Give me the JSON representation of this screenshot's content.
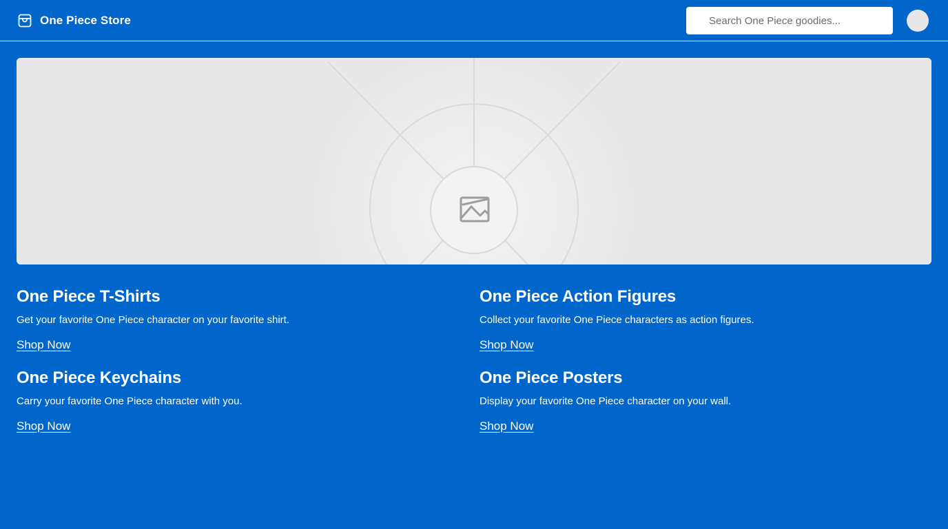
{
  "header": {
    "title": "One Piece Store",
    "search": {
      "placeholder": "Search One Piece goodies...",
      "value": ""
    }
  },
  "hero": {
    "image": "image-placeholder-icon"
  },
  "products": [
    {
      "title": "One Piece T-Shirts",
      "description": "Get your favorite One Piece character on your favorite shirt.",
      "link": "Shop Now"
    },
    {
      "title": "One Piece Action Figures",
      "description": "Collect your favorite One Piece characters as action figures.",
      "link": "Shop Now"
    },
    {
      "title": "One Piece Keychains",
      "description": "Carry your favorite One Piece character with you.",
      "link": "Shop Now"
    },
    {
      "title": "One Piece Posters",
      "description": "Display your favorite One Piece character on your wall.",
      "link": "Shop Now"
    }
  ],
  "colors": {
    "background": "#0066cc",
    "text": "#ffffff",
    "placeholder_bg": "#e8e8e8"
  }
}
